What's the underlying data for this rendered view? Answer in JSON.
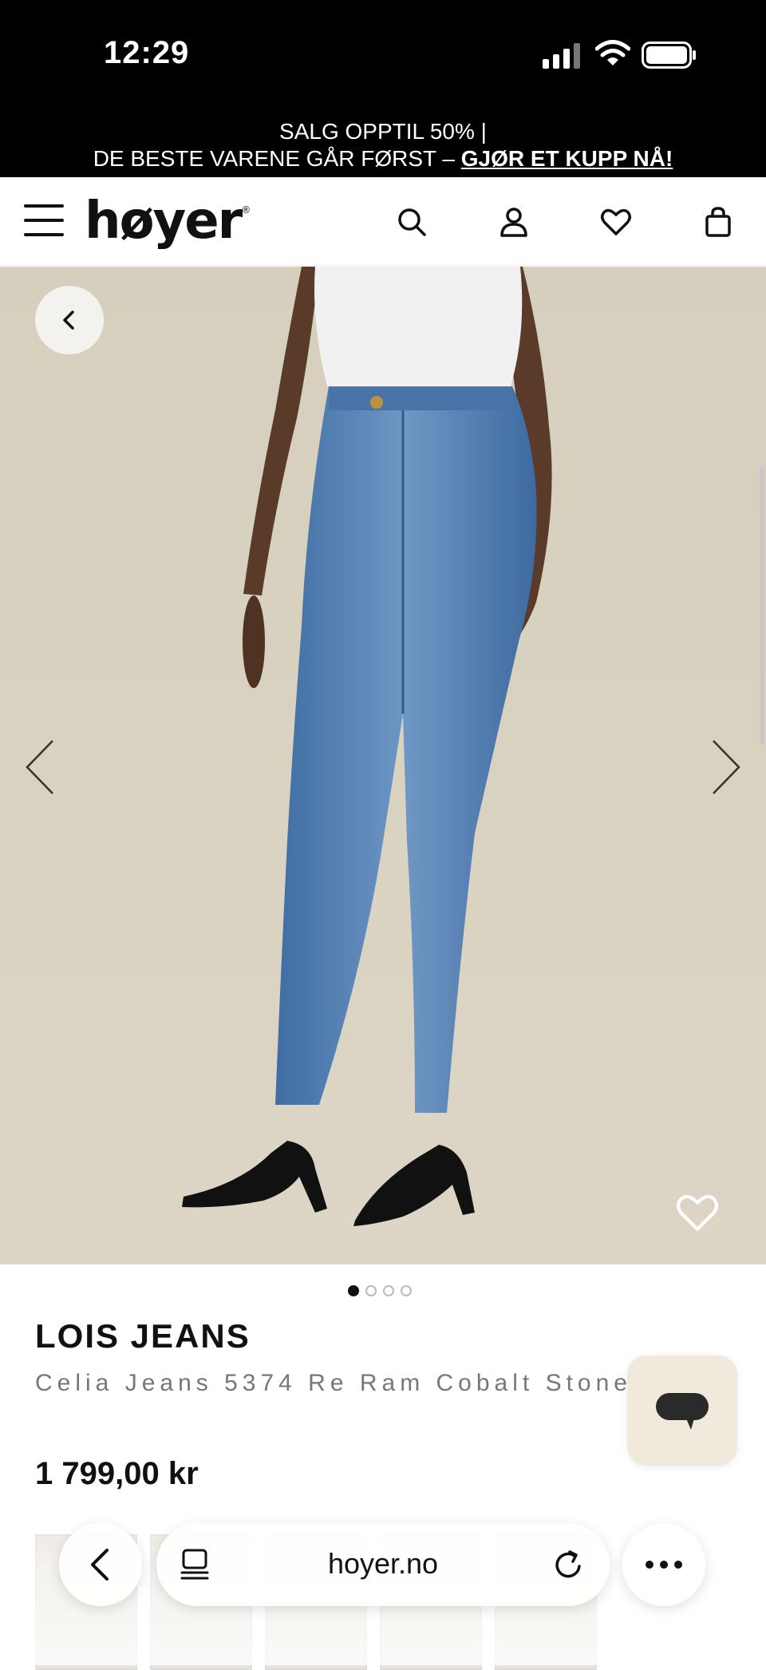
{
  "status_bar": {
    "time": "12:29"
  },
  "promo": {
    "line1": "SALG OPPTIL 50%  |",
    "line2_text": "DE BESTE VARENE GÅR FØRST – ",
    "line2_cta": "GJØR ET KUPP NÅ!"
  },
  "header": {
    "logo": "høyer",
    "logo_mark": "®"
  },
  "product": {
    "brand": "LOIS JEANS",
    "name": "Celia Jeans 5374 Re Ram Cobalt Stone",
    "price": "1 799,00 kr",
    "image_count": 4,
    "active_image": 1
  },
  "browser": {
    "url": "hoyer.no"
  },
  "colors": {
    "banner_bg": "#000000",
    "hero_bg": "#d9d1c0",
    "chat_bg": "#f2e9dd",
    "price_text": "#111111",
    "name_text": "#777777"
  },
  "icons": [
    "signal-icon",
    "wifi-icon",
    "battery-icon",
    "menu-icon",
    "search-icon",
    "account-icon",
    "heart-icon",
    "bag-icon",
    "chevron-left-icon",
    "chevron-right-icon",
    "chat-icon",
    "tabs-icon",
    "reload-icon",
    "more-icon"
  ]
}
